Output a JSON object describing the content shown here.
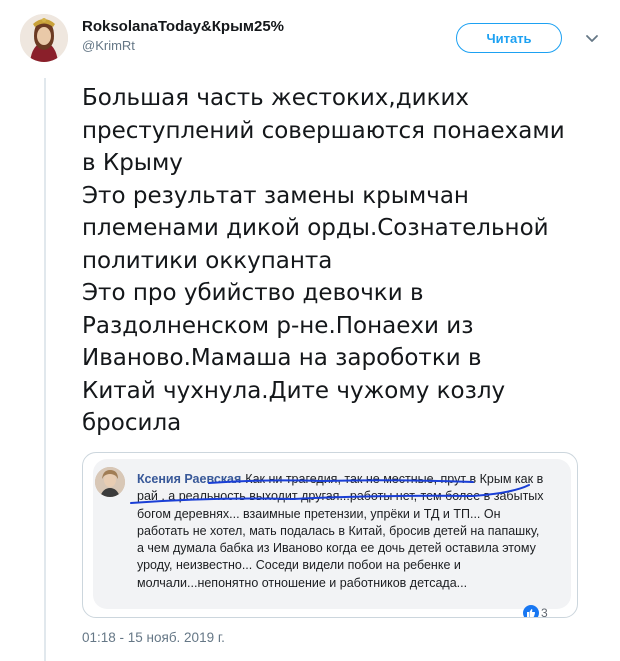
{
  "header": {
    "display_name": "RoksolanaToday&Крым25%",
    "handle": "@KrimRt",
    "follow_label": "Читать",
    "avatar_icon": "avatar-icon",
    "menu_icon": "chevron-down-icon"
  },
  "tweet": {
    "text": "Большая часть жестоких,диких\nпреступлений совершаются понаехами\nв Крыму\nЭто результат замены крымчан\nплеменами дикой орды.Сознательной\nполитики оккупанта\nЭто про убийство девочки в\nРаздолненском р-не.Понаехи из\nИваново.Мамаша на зароботки в\nКитай чухнула.Дите чужому козлу\nбросила",
    "timestamp": "01:18 - 15 нояб. 2019 г."
  },
  "media": {
    "comment_author": "Ксения Раевская",
    "comment_text": "Как ни трагедия, так не местные, прут в Крым как в рай , а реальность выходит другая...работы нет, тем более в забытых богом деревнях... взаимные претензии, упрёки и ТД и ТП... Он работать не хотел, мать подалась в Китай, бросив детей на папашку, а чем думала бабка из Иваново когда ее дочь детей оставила этому уроду, неизвестно... Соседи видели побои на ребенке и молчали...непонятно отношение и работников детсада...",
    "reaction_count": "3",
    "like_icon": "like-icon",
    "annotation_color": "#1a3fd6"
  },
  "colors": {
    "accent": "#1da1f2",
    "fb_name": "#385898",
    "muted": "#657786"
  }
}
